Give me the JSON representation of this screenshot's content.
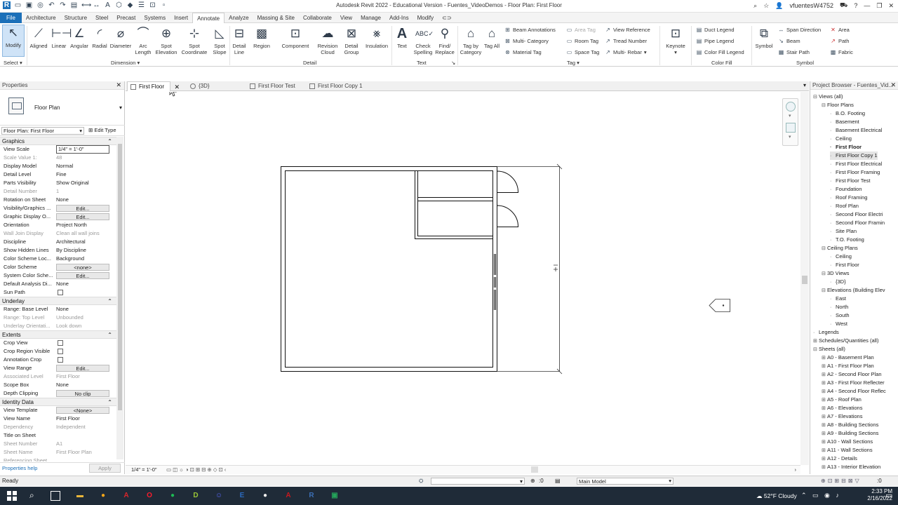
{
  "app": {
    "title": "Autodesk Revit 2022 - Educational Version - Fuentes_VideoDemos - Floor Plan: First Floor",
    "user": "vfuentesW4752"
  },
  "menu": [
    "File",
    "Architecture",
    "Structure",
    "Steel",
    "Precast",
    "Systems",
    "Insert",
    "Annotate",
    "Analyze",
    "Massing & Site",
    "Collaborate",
    "View",
    "Manage",
    "Add-Ins",
    "Modify"
  ],
  "menu_active": "Annotate",
  "ribbon": {
    "modify": "Modify",
    "select": "Select",
    "dimension_tools": [
      "Aligned",
      "Linear",
      "Angular",
      "Radial",
      "Diameter",
      "Arc Length",
      "Spot Elevation",
      "Spot Coordinate",
      "Spot Slope"
    ],
    "dimension_label": "Dimension",
    "detail_tools": [
      "Detail Line",
      "Region",
      "Component",
      "Revision Cloud",
      "Detail Group",
      "Insulation"
    ],
    "detail_label": "Detail",
    "text_tools": [
      "Text",
      "Check Spelling",
      "Find/ Replace"
    ],
    "text_label": "Text",
    "tag_tools": [
      "Tag by Category",
      "Tag All"
    ],
    "tag_small": [
      "Beam Annotations",
      "Multi- Category",
      "Material Tag",
      "Area Tag",
      "Room Tag",
      "Space Tag",
      "View Reference",
      "Tread Number",
      "Multi- Rebar"
    ],
    "tag_label": "Tag",
    "keynote": "Keynote",
    "colorfill_small": [
      "Duct Legend",
      "Pipe Legend",
      "Color Fill Legend"
    ],
    "colorfill_label": "Color Fill",
    "symbol": "Symbol",
    "symbol_small": [
      "Span Direction",
      "Beam",
      "Stair Path",
      "Area",
      "Path",
      "Fabric"
    ],
    "symbol_label": "Symbol"
  },
  "properties": {
    "title": "Properties",
    "type_name": "Floor Plan",
    "instance": "Floor Plan: First Floor",
    "edit_type": "Edit Type",
    "help": "Properties help",
    "apply": "Apply",
    "groups": [
      {
        "name": "Graphics",
        "rows": [
          {
            "k": "View Scale",
            "v": "1/4\" = 1'-0\"",
            "t": "box"
          },
          {
            "k": "Scale Value    1:",
            "v": "48",
            "t": "dim"
          },
          {
            "k": "Display Model",
            "v": "Normal"
          },
          {
            "k": "Detail Level",
            "v": "Fine"
          },
          {
            "k": "Parts Visibility",
            "v": "Show Original"
          },
          {
            "k": "Detail Number",
            "v": "1",
            "t": "dim"
          },
          {
            "k": "Rotation on Sheet",
            "v": "None"
          },
          {
            "k": "Visibility/Graphics ...",
            "v": "Edit...",
            "t": "btn"
          },
          {
            "k": "Graphic Display O...",
            "v": "Edit...",
            "t": "btn"
          },
          {
            "k": "Orientation",
            "v": "Project North"
          },
          {
            "k": "Wall Join Display",
            "v": "Clean all wall joins",
            "t": "dim"
          },
          {
            "k": "Discipline",
            "v": "Architectural"
          },
          {
            "k": "Show Hidden Lines",
            "v": "By Discipline"
          },
          {
            "k": "Color Scheme Loc...",
            "v": "Background"
          },
          {
            "k": "Color Scheme",
            "v": "<none>",
            "t": "btn"
          },
          {
            "k": "System Color Sche...",
            "v": "Edit...",
            "t": "btn"
          },
          {
            "k": "Default Analysis Di...",
            "v": "None"
          },
          {
            "k": "Sun Path",
            "v": "",
            "t": "cb"
          }
        ]
      },
      {
        "name": "Underlay",
        "rows": [
          {
            "k": "Range: Base Level",
            "v": "None"
          },
          {
            "k": "Range: Top Level",
            "v": "Unbounded",
            "t": "dim"
          },
          {
            "k": "Underlay Orientati...",
            "v": "Look down",
            "t": "dim"
          }
        ]
      },
      {
        "name": "Extents",
        "rows": [
          {
            "k": "Crop View",
            "v": "",
            "t": "cb"
          },
          {
            "k": "Crop Region Visible",
            "v": "",
            "t": "cb"
          },
          {
            "k": "Annotation Crop",
            "v": "",
            "t": "cb"
          },
          {
            "k": "View Range",
            "v": "Edit...",
            "t": "btn"
          },
          {
            "k": "Associated Level",
            "v": "First Floor",
            "t": "dim"
          },
          {
            "k": "Scope Box",
            "v": "None"
          },
          {
            "k": "Depth Clipping",
            "v": "No clip",
            "t": "btn"
          }
        ]
      },
      {
        "name": "Identity Data",
        "rows": [
          {
            "k": "View Template",
            "v": "<None>",
            "t": "btn"
          },
          {
            "k": "View Name",
            "v": "First Floor"
          },
          {
            "k": "Dependency",
            "v": "Independent",
            "t": "dim"
          },
          {
            "k": "Title on Sheet",
            "v": ""
          },
          {
            "k": "Sheet Number",
            "v": "A1",
            "t": "dim"
          },
          {
            "k": "Sheet Name",
            "v": "First Floor Plan",
            "t": "dim"
          },
          {
            "k": "Referencing Sheet",
            "v": "",
            "t": "dim"
          }
        ]
      }
    ]
  },
  "view_tabs": [
    {
      "label": "First Floor",
      "active": true
    },
    {
      "label": "{3D}"
    },
    {
      "label": "First Floor Test"
    },
    {
      "label": "First Floor Copy 1"
    }
  ],
  "view_control": {
    "scale": "1/4\" = 1'-0\""
  },
  "browser": {
    "title": "Project Browser - Fuentes_Vid...",
    "nodes": [
      {
        "label": "Views (all)",
        "lvl": 0,
        "tg": "-"
      },
      {
        "label": "Floor Plans",
        "lvl": 1,
        "tg": "-"
      },
      {
        "label": "B.O. Footing",
        "lvl": 2
      },
      {
        "label": "Basement",
        "lvl": 2
      },
      {
        "label": "Basement Electrical",
        "lvl": 2
      },
      {
        "label": "Ceiling",
        "lvl": 2
      },
      {
        "label": "First Floor",
        "lvl": 2,
        "bold": true
      },
      {
        "label": "First Floor Copy 1",
        "lvl": 2,
        "hl": true
      },
      {
        "label": "First Floor Electrical",
        "lvl": 2
      },
      {
        "label": "First Floor Framing",
        "lvl": 2
      },
      {
        "label": "First Floor Test",
        "lvl": 2
      },
      {
        "label": "Foundation",
        "lvl": 2
      },
      {
        "label": "Roof Framing",
        "lvl": 2
      },
      {
        "label": "Roof Plan",
        "lvl": 2
      },
      {
        "label": "Second Floor Electri",
        "lvl": 2
      },
      {
        "label": "Second Floor Framin",
        "lvl": 2
      },
      {
        "label": "Site Plan",
        "lvl": 2
      },
      {
        "label": "T.O. Footing",
        "lvl": 2
      },
      {
        "label": "Ceiling Plans",
        "lvl": 1,
        "tg": "-"
      },
      {
        "label": "Ceiling",
        "lvl": 2
      },
      {
        "label": "First Floor",
        "lvl": 2
      },
      {
        "label": "3D Views",
        "lvl": 1,
        "tg": "-"
      },
      {
        "label": "{3D}",
        "lvl": 2
      },
      {
        "label": "Elevations (Building Elev",
        "lvl": 1,
        "tg": "-"
      },
      {
        "label": "East",
        "lvl": 2
      },
      {
        "label": "North",
        "lvl": 2
      },
      {
        "label": "South",
        "lvl": 2
      },
      {
        "label": "West",
        "lvl": 2
      },
      {
        "label": "Legends",
        "lvl": 0,
        "tg": ""
      },
      {
        "label": "Schedules/Quantities (all)",
        "lvl": 0,
        "tg": "+"
      },
      {
        "label": "Sheets (all)",
        "lvl": 0,
        "tg": "-"
      },
      {
        "label": "A0 - Basement Plan",
        "lvl": 1,
        "tg": "+"
      },
      {
        "label": "A1 - First Floor Plan",
        "lvl": 1,
        "tg": "+"
      },
      {
        "label": "A2 - Second Floor Plan",
        "lvl": 1,
        "tg": "+"
      },
      {
        "label": "A3 - First Floor Reflecter",
        "lvl": 1,
        "tg": "+"
      },
      {
        "label": "A4 - Second Floor Reflec",
        "lvl": 1,
        "tg": "+"
      },
      {
        "label": "A5 - Roof Plan",
        "lvl": 1,
        "tg": "+"
      },
      {
        "label": "A6 - Elevations",
        "lvl": 1,
        "tg": "+"
      },
      {
        "label": "A7 - Elevations",
        "lvl": 1,
        "tg": "+"
      },
      {
        "label": "A8 - Building Sections",
        "lvl": 1,
        "tg": "+"
      },
      {
        "label": "A9 - Building Sections",
        "lvl": 1,
        "tg": "+"
      },
      {
        "label": "A10 - Wall Sections",
        "lvl": 1,
        "tg": "+"
      },
      {
        "label": "A11 - Wall Sections",
        "lvl": 1,
        "tg": "+"
      },
      {
        "label": "A12 - Details",
        "lvl": 1,
        "tg": "+"
      },
      {
        "label": "A13 - Interior Elevation",
        "lvl": 1,
        "tg": "+"
      }
    ]
  },
  "status": {
    "text": "Ready",
    "zero": ":0",
    "model": "Main Model"
  },
  "taskbar": {
    "weather": "52°F  Cloudy",
    "time": "2:33 PM",
    "date": "2/16/2022",
    "icons": [
      {
        "name": "file-explorer-icon",
        "g": "▬",
        "c": "#e9b53a"
      },
      {
        "name": "chrome-canary-icon",
        "g": "●",
        "c": "#f3a51a"
      },
      {
        "name": "acrobat-icon",
        "g": "A",
        "c": "#d9262b"
      },
      {
        "name": "opera-icon",
        "g": "O",
        "c": "#ff1b2d"
      },
      {
        "name": "spotify-icon",
        "g": "●",
        "c": "#1db954"
      },
      {
        "name": "d-app-icon",
        "g": "D",
        "c": "#9bc637"
      },
      {
        "name": "discord-icon",
        "g": "☺",
        "c": "#5865f2"
      },
      {
        "name": "e-app-icon",
        "g": "E",
        "c": "#2b6bbf"
      },
      {
        "name": "github-icon",
        "g": "●",
        "c": "#eeeeee"
      },
      {
        "name": "acrobat-pro-icon",
        "g": "A",
        "c": "#c8181e"
      },
      {
        "name": "revit-icon",
        "g": "R",
        "c": "#3c6fb5"
      },
      {
        "name": "camtasia-icon",
        "g": "▣",
        "c": "#24a35a"
      }
    ]
  },
  "colors": {
    "accent": "#1c70b9",
    "select_bg": "#cfe3f7"
  }
}
